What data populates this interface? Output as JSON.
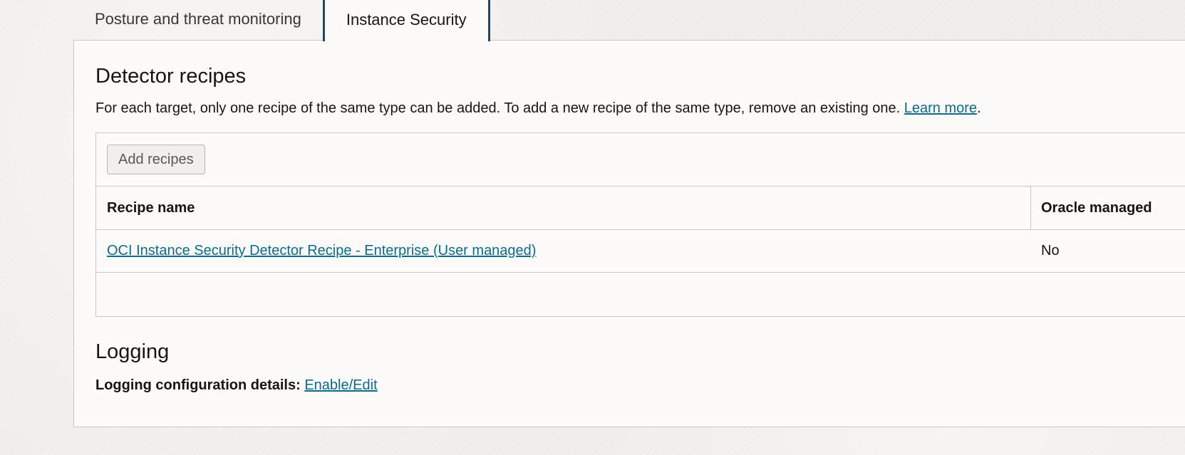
{
  "tabs": [
    {
      "label": "Posture and threat monitoring",
      "active": false
    },
    {
      "label": "Instance Security",
      "active": true
    }
  ],
  "detector_recipes": {
    "title": "Detector recipes",
    "description": "For each target, only one recipe of the same type can be added. To add a new recipe of the same type, remove an existing one.",
    "learn_more_label": "Learn more",
    "description_suffix": ".",
    "add_button_label": "Add recipes",
    "columns": [
      "Recipe name",
      "Oracle managed"
    ],
    "rows": [
      {
        "name": "OCI Instance Security Detector Recipe - Enterprise (User managed)",
        "oracle_managed": "No"
      }
    ]
  },
  "logging": {
    "title": "Logging",
    "config_label": "Logging configuration details:",
    "config_link_label": "Enable/Edit"
  },
  "colors": {
    "accent": "#1e4a66",
    "link": "#0e6a8a",
    "border": "#c9c6c2",
    "panel_bg": "#fcfbfa",
    "page_bg": "#f1efed"
  }
}
